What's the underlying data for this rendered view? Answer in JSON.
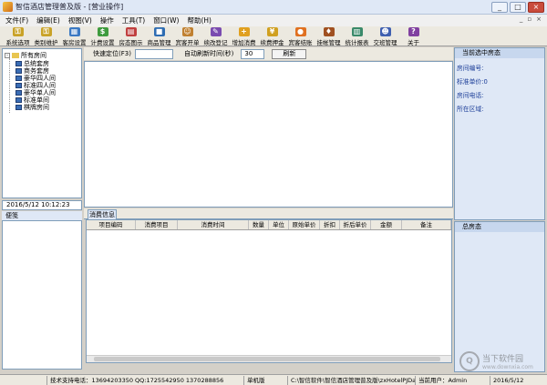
{
  "window": {
    "title": "智信酒店管理普及版 - [营业操作]",
    "btn_min": "_",
    "btn_max": "□",
    "btn_close": "×"
  },
  "menu": {
    "items": [
      "文件(F)",
      "编辑(E)",
      "视图(V)",
      "操作",
      "工具(T)",
      "窗口(W)",
      "帮助(H)"
    ],
    "mdi_controls": [
      "_",
      "▫",
      "×"
    ]
  },
  "toolbar": {
    "buttons": [
      {
        "label": "系统选项",
        "icon": "key-icon",
        "color": "#c9a227"
      },
      {
        "label": "类别维护",
        "icon": "key-icon",
        "color": "#c9a227"
      },
      {
        "label": "客房设置",
        "icon": "room-icon",
        "color": "#3a78c3"
      },
      {
        "label": "计费设置",
        "icon": "money-icon",
        "color": "#3e9b3e"
      },
      {
        "label": "房态图示",
        "icon": "chart-icon",
        "color": "#c03f3f"
      },
      {
        "label": "商品管理",
        "icon": "goods-icon",
        "color": "#2f6db3"
      },
      {
        "label": "宾客开单",
        "icon": "person-icon",
        "color": "#c08030"
      },
      {
        "label": "续改登记",
        "icon": "edit-icon",
        "color": "#7a4bb0"
      },
      {
        "label": "增加消费",
        "icon": "plus-icon",
        "color": "#e0a020"
      },
      {
        "label": "续费押金",
        "icon": "coin-icon",
        "color": "#d0a020"
      },
      {
        "label": "宾客结账",
        "icon": "checkout-icon",
        "color": "#e07020"
      },
      {
        "label": "挂帐管理",
        "icon": "bag-icon",
        "color": "#a05020"
      },
      {
        "label": "统计报表",
        "icon": "report-icon",
        "color": "#3a8a6a"
      },
      {
        "label": "交班管理",
        "icon": "people-icon",
        "color": "#4060b0"
      },
      {
        "label": "关于",
        "icon": "help-icon",
        "color": "#8040a0"
      }
    ]
  },
  "tree": {
    "root": "所有房间",
    "children": [
      "总统套房",
      "商务套房",
      "豪华四人间",
      "标准四人间",
      "豪华单人间",
      "标准单间",
      "棋牌房间"
    ]
  },
  "datetime": "2016/5/12  10:12:23",
  "memo": {
    "title": "便笺"
  },
  "quick": {
    "locate_label": "快速定位(F3)",
    "refresh_label": "自动刷新时间(秒)",
    "refresh_value": "30",
    "refresh_button": "刷新"
  },
  "consume_tab": "消费信息",
  "grid": {
    "columns": [
      "项目编码",
      "消费项目",
      "消费时间",
      "数量",
      "单位",
      "原始单价",
      "折扣",
      "折后单价",
      "金额",
      "备注"
    ]
  },
  "right_panel": {
    "title": "当前选中房态",
    "rows": [
      "房间编号:",
      "标准单价:0",
      "房间电话:",
      "所在区域:"
    ],
    "summary_title": "总房态"
  },
  "statusbar": {
    "support": "技术支持电话：13694203350 QQ:1725542950 1370288856",
    "mode": "单机版",
    "db_path": "C:\\智信软件\\智信酒店管理普及版\\zxHotelPJData.sys",
    "user": "当前用户：Admin",
    "date": "2016/5/12"
  },
  "watermark": {
    "logo": "Q",
    "text": "当下软件园",
    "url": "www.downxia.com"
  }
}
